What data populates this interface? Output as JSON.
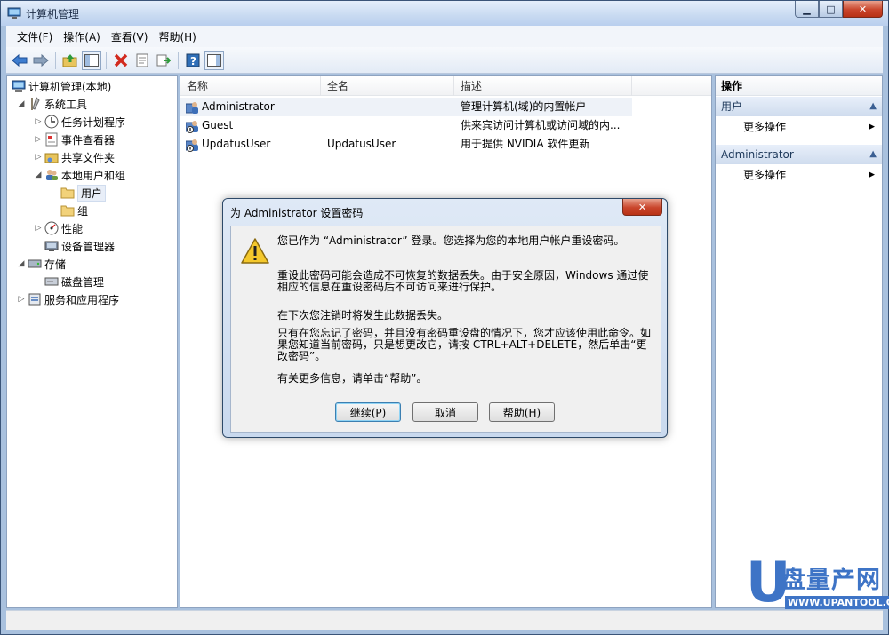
{
  "window": {
    "title": "计算机管理",
    "minimize": "▁",
    "maximize": "□",
    "close": "✕"
  },
  "menu": [
    "文件(F)",
    "操作(A)",
    "查看(V)",
    "帮助(H)"
  ],
  "tree": {
    "root": "计算机管理(本地)",
    "system_tools": "系统工具",
    "task_scheduler": "任务计划程序",
    "event_viewer": "事件查看器",
    "shared_folders": "共享文件夹",
    "local_users_groups": "本地用户和组",
    "users": "用户",
    "groups": "组",
    "performance": "性能",
    "device_manager": "设备管理器",
    "storage": "存储",
    "disk_management": "磁盘管理",
    "services_apps": "服务和应用程序"
  },
  "list": {
    "columns": [
      "名称",
      "全名",
      "描述"
    ],
    "rows": [
      {
        "name": "Administrator",
        "fullname": "",
        "desc": "管理计算机(域)的内置帐户"
      },
      {
        "name": "Guest",
        "fullname": "",
        "desc": "供来宾访问计算机或访问域的内..."
      },
      {
        "name": "UpdatusUser",
        "fullname": "UpdatusUser",
        "desc": "用于提供 NVIDIA 软件更新"
      }
    ]
  },
  "actions": {
    "header": "操作",
    "section1": "用户",
    "more1": "更多操作",
    "section2": "Administrator",
    "more2": "更多操作"
  },
  "dialog": {
    "title": "为 Administrator 设置密码",
    "close": "✕",
    "line1": "您已作为 “Administrator” 登录。您选择为您的本地用户帐户重设密码。",
    "para2": "重设此密码可能会造成不可恢复的数据丢失。由于安全原因，Windows 通过使相应的信息在重设密码后不可访问来进行保护。",
    "line3": "在下次您注销时将发生此数据丢失。",
    "para4": "只有在您忘记了密码，并且没有密码重设盘的情况下，您才应该使用此命令。如果您知道当前密码，只是想更改它，请按 CTRL+ALT+DELETE，然后单击“更改密码”。",
    "line5": "有关更多信息，请单击“帮助”。",
    "btn_continue": "继续(P)",
    "btn_cancel": "取消",
    "btn_help": "帮助(H)"
  },
  "watermark": {
    "letter": "U",
    "text": "盘量产网",
    "url": "WWW.UPANTOOL.COM"
  },
  "colors": {
    "accent": "#3e74c6",
    "frame": "#a9c1de",
    "close_red": "#c9452b"
  }
}
